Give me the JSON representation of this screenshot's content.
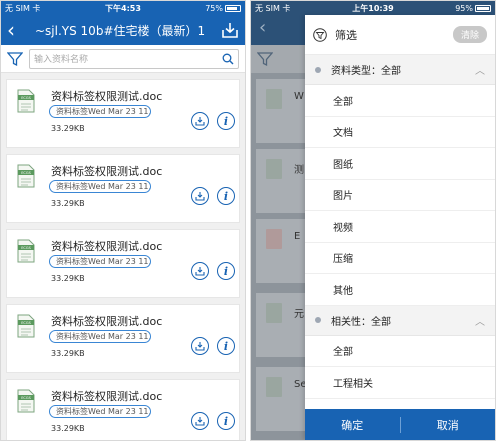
{
  "left": {
    "status": {
      "carrier": "无 SIM 卡",
      "time": "下午4:53",
      "battery": "75%"
    },
    "nav": {
      "back": "‹",
      "title": "~sjl.YS   10b#住宅楼（最新）1"
    },
    "search": {
      "placeholder": "输入资料名称"
    },
    "files": [
      {
        "name": "资料标签权限测试.doc",
        "tag": "资料标签Wed Mar 23 11...",
        "size": "33.29KB"
      },
      {
        "name": "资料标签权限测试.doc",
        "tag": "资料标签Wed Mar 23 11...",
        "size": "33.29KB"
      },
      {
        "name": "资料标签权限测试.doc",
        "tag": "资料标签Wed Mar 23 11...",
        "size": "33.29KB"
      },
      {
        "name": "资料标签权限测试.doc",
        "tag": "资料标签Wed Mar 23 11...",
        "size": "33.29KB"
      },
      {
        "name": "资料标签权限测试.doc",
        "tag": "资料标签Wed Mar 23 11...",
        "size": "33.29KB"
      }
    ],
    "icon_label": "ECGS"
  },
  "right": {
    "status": {
      "carrier": "无 SIM 卡",
      "time": "上午10:39",
      "battery": "95%"
    },
    "behind_initials": [
      "W",
      "测",
      "E",
      "元",
      "Se"
    ],
    "drawer": {
      "title": "筛选",
      "clear": "清除",
      "section1": {
        "label": "资料类型：全部",
        "options": [
          "全部",
          "文档",
          "图纸",
          "图片",
          "视频",
          "压缩",
          "其他"
        ]
      },
      "section2": {
        "label": "相关性：全部",
        "options": [
          "全部",
          "工程相关"
        ]
      },
      "confirm": "确定",
      "cancel": "取消"
    }
  },
  "colors": {
    "primary": "#1863b3",
    "tag_border": "#3a86d4"
  }
}
